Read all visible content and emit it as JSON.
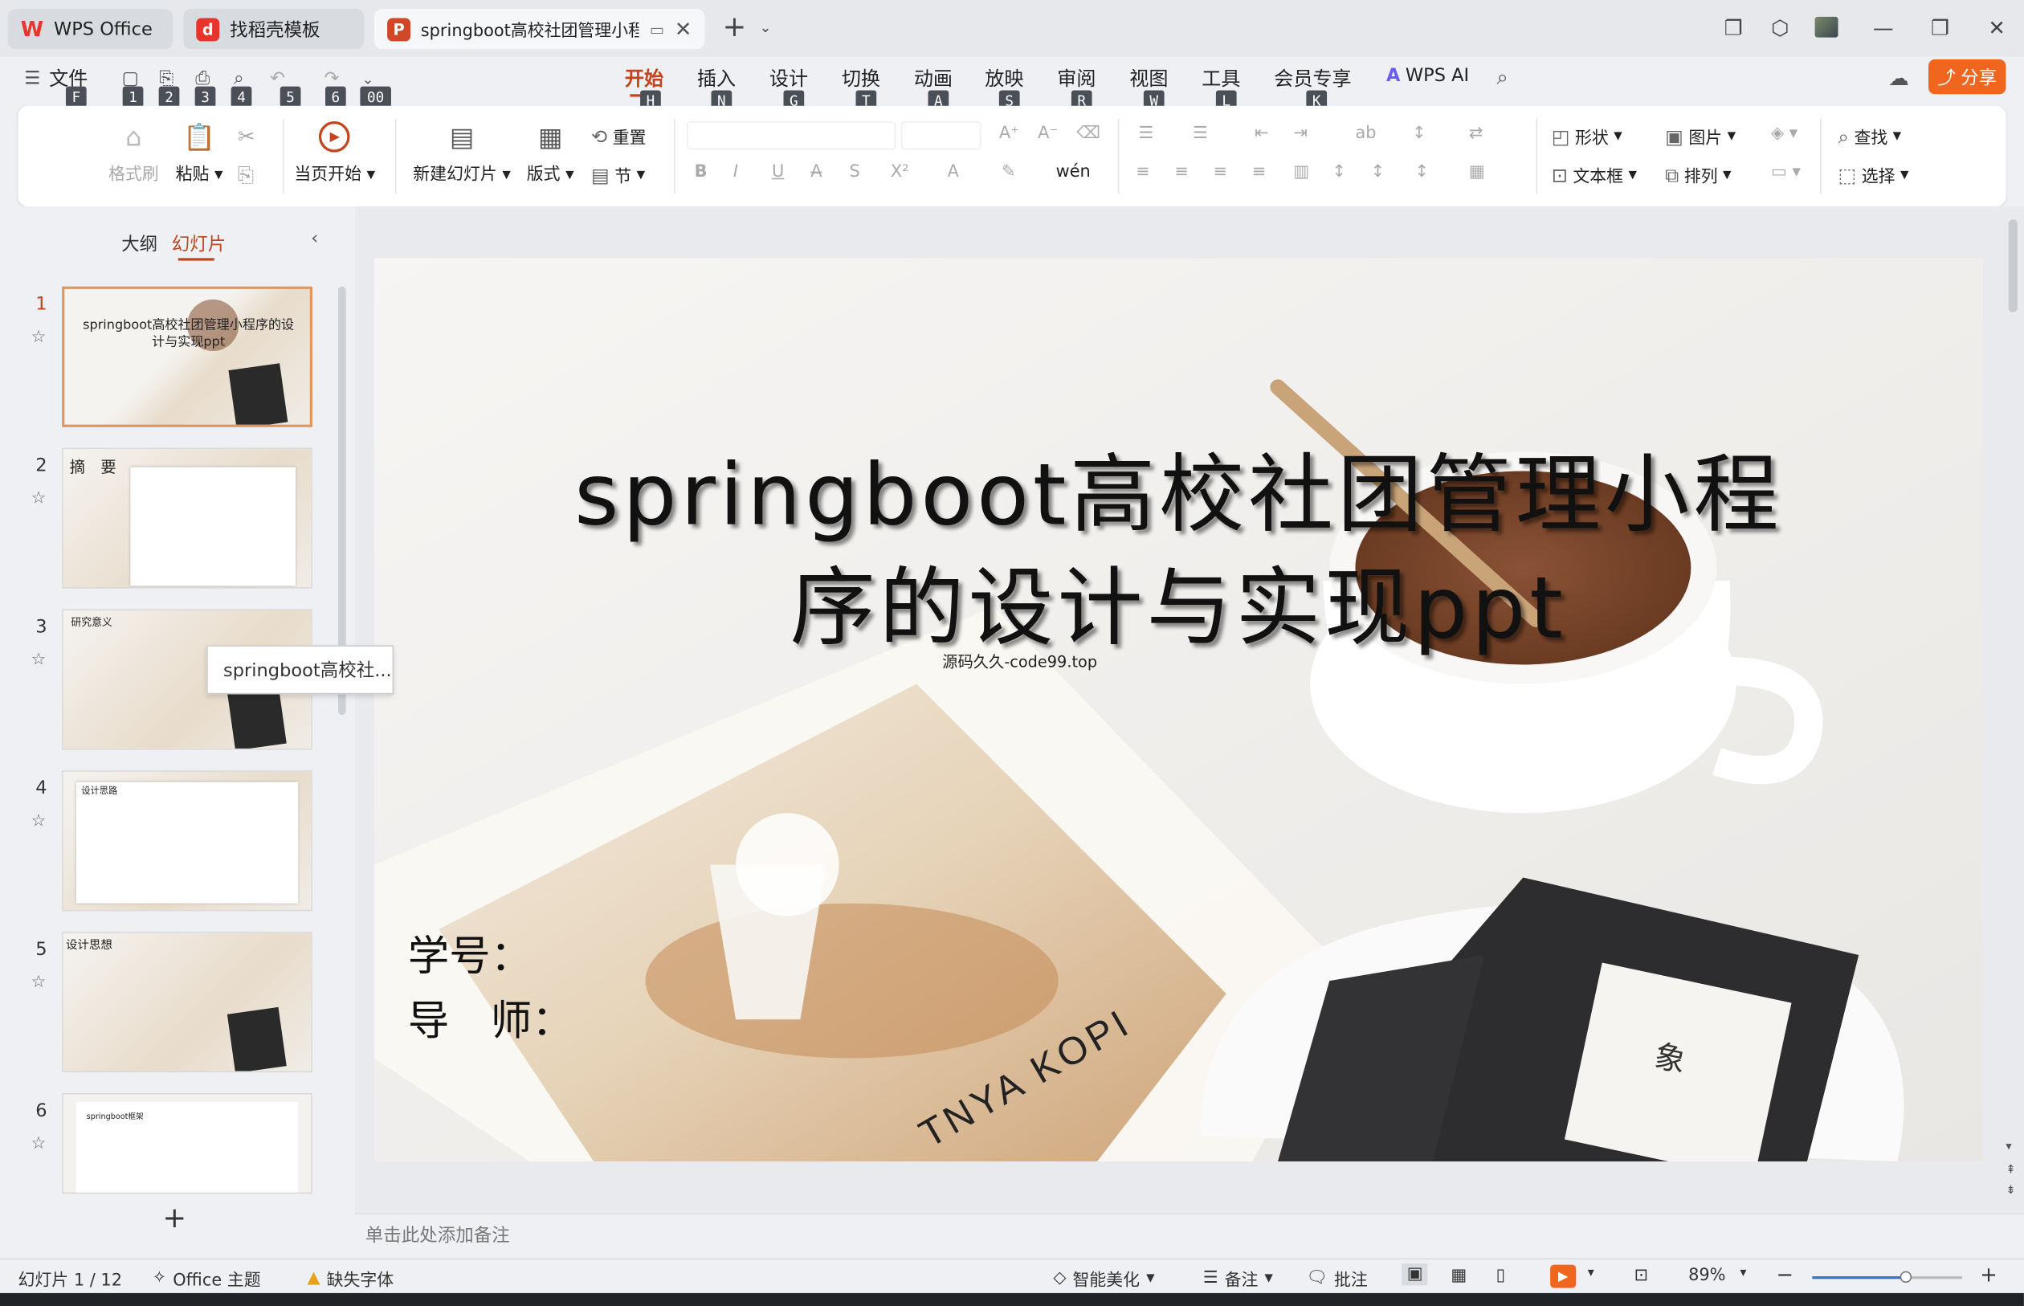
{
  "tabs": [
    {
      "label": "WPS Office",
      "icon": "wps-logo-icon"
    },
    {
      "label": "找稻壳模板",
      "icon": "docer-icon"
    },
    {
      "label": "springboot高校社团管理小程",
      "icon": "ppt-file-icon"
    }
  ],
  "menu": {
    "file_label": "文件",
    "file_key": "F",
    "quick_keys": [
      "1",
      "2",
      "3",
      "4",
      "5",
      "6",
      "00"
    ],
    "tabs": [
      {
        "label": "开始",
        "key": "H"
      },
      {
        "label": "插入",
        "key": "N"
      },
      {
        "label": "设计",
        "key": "G"
      },
      {
        "label": "切换",
        "key": "T"
      },
      {
        "label": "动画",
        "key": "A"
      },
      {
        "label": "放映",
        "key": "S"
      },
      {
        "label": "审阅",
        "key": "R"
      },
      {
        "label": "视图",
        "key": "W"
      },
      {
        "label": "工具",
        "key": "L"
      },
      {
        "label": "会员专享",
        "key": "K"
      }
    ],
    "wps_ai_label": "WPS AI",
    "share_label": "分享"
  },
  "ribbon": {
    "format_painter": "格式刷",
    "paste": "粘贴",
    "start_from_current": "当页开始",
    "new_slide": "新建幻灯片",
    "layout": "版式",
    "reset": "重置",
    "section": "节",
    "shape": "形状",
    "picture": "图片",
    "textbox": "文本框",
    "arrange": "排列",
    "find": "查找",
    "select": "选择"
  },
  "left_panel": {
    "tab_outline": "大纲",
    "tab_slides": "幻灯片",
    "tooltip": "springboot高校社...",
    "slides": [
      {
        "num": "1",
        "title": "springboot高校社团管理小程序的设计与实现ppt"
      },
      {
        "num": "2",
        "title": "摘　要"
      },
      {
        "num": "3",
        "title": "研究意义"
      },
      {
        "num": "4",
        "title": "设计思路"
      },
      {
        "num": "5",
        "title": "设计思想"
      },
      {
        "num": "6",
        "title": "springboot框架"
      }
    ]
  },
  "slide": {
    "title_line1": "springboot高校社团管理小程",
    "title_line2": "序的设计与实现ppt",
    "watermark": "源码久久-code99.top",
    "student_id_label": "学号：",
    "advisor_label": "导　师：",
    "cup_text": "TNYA KOPI",
    "bag_char": "象"
  },
  "notes_placeholder": "单击此处添加备注",
  "status": {
    "slide_counter": "幻灯片 1 / 12",
    "theme": "Office 主题",
    "missing_font": "缺失字体",
    "beautify": "智能美化",
    "notes": "备注",
    "comments": "批注",
    "zoom": "89%",
    "zoom_level": 0.62
  },
  "colors": {
    "accent": "#c4441c",
    "share_btn": "#f0661e",
    "wps_red": "#e8352b",
    "ppt_orange": "#d24726"
  }
}
